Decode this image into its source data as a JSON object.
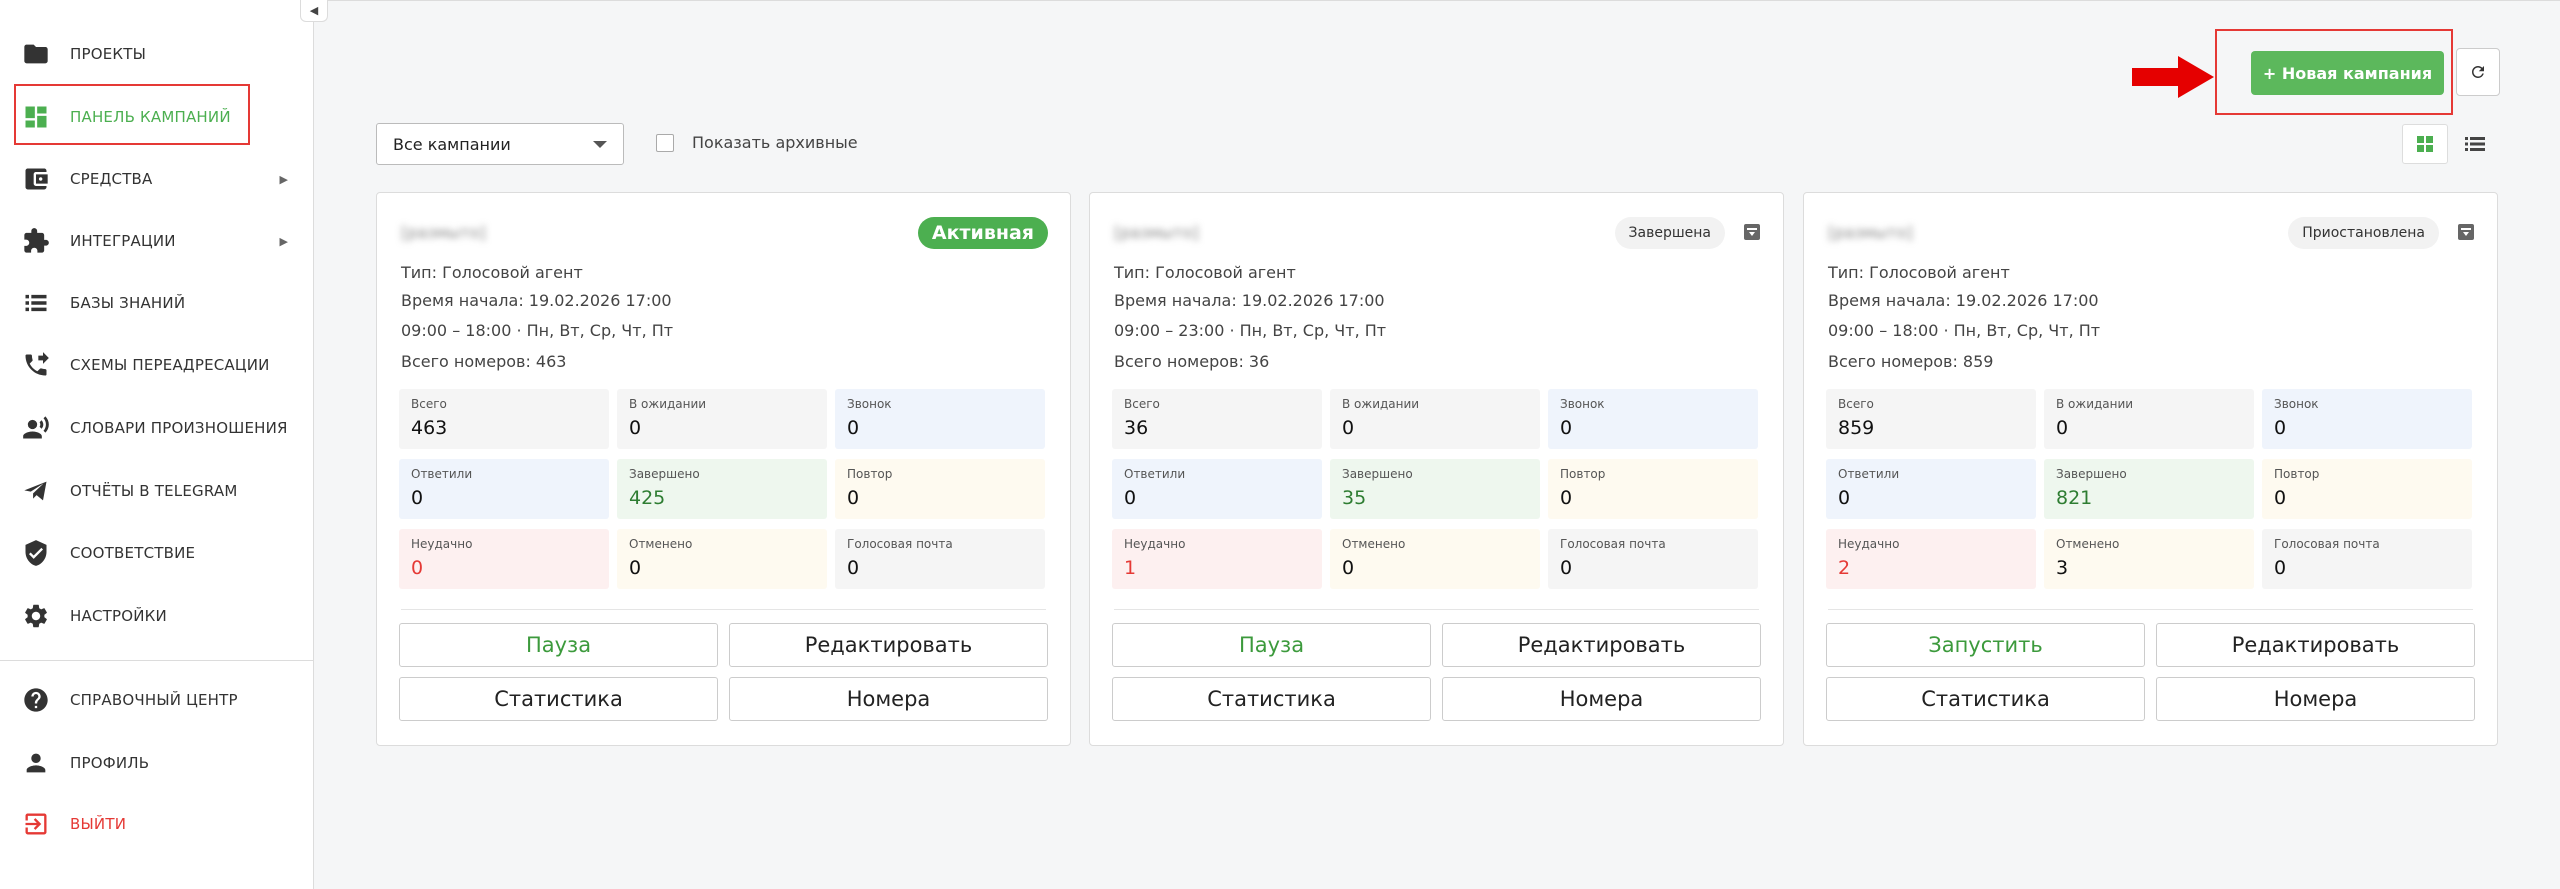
{
  "sidebar": {
    "items": [
      {
        "label": "ПРОЕКТЫ"
      },
      {
        "label": "ПАНЕЛЬ КАМПАНИЙ"
      },
      {
        "label": "СРЕДСТВА"
      },
      {
        "label": "ИНТЕГРАЦИИ"
      },
      {
        "label": "БАЗЫ ЗНАНИЙ"
      },
      {
        "label": "СХЕМЫ ПЕРЕАДРЕСАЦИИ"
      },
      {
        "label": "СЛОВАРИ ПРОИЗНОШЕНИЯ"
      },
      {
        "label": "ОТЧЁТЫ В TELEGRAM"
      },
      {
        "label": "СООТВЕТСТВИЕ"
      },
      {
        "label": "НАСТРОЙКИ"
      },
      {
        "label": "СПРАВОЧНЫЙ ЦЕНТР"
      },
      {
        "label": "ПРОФИЛЬ"
      },
      {
        "label": "ВЫЙТИ"
      }
    ],
    "active_item": "ПАНЕЛЬ КАМПАНИЙ"
  },
  "toolbar": {
    "new_campaign_label": "+ Новая кампания",
    "filter_value": "Все кампании",
    "show_archived_label": "Показать архивные",
    "show_archived_checked": false,
    "view_mode": "grid"
  },
  "colors": {
    "accent": "#4caf50",
    "highlight": "#e53935",
    "danger": "#e53935"
  },
  "stat_labels": {
    "total": "Всего",
    "waiting": "В ожидании",
    "calling": "Звонок",
    "answered": "Ответили",
    "completed": "Завершено",
    "retry": "Повтор",
    "failed": "Неудачно",
    "cancelled": "Отменено",
    "voicemail": "Голосовая почта"
  },
  "campaigns": [
    {
      "name": "[размыто]",
      "status": "Активная",
      "type": "Тип: Голосовой агент",
      "start": "Время начала: 19.02.2026 17:00",
      "schedule": "09:00 – 18:00 · Пн, Вт, Ср, Чт, Пт",
      "total_numbers": "Всего номеров: 463",
      "stats": {
        "total": "463",
        "waiting": "0",
        "calling": "0",
        "answered": "0",
        "completed": "425",
        "retry": "0",
        "failed": "0",
        "cancelled": "0",
        "voicemail": "0"
      },
      "buttons": {
        "primary": "Пауза",
        "edit": "Редактировать",
        "stats": "Статистика",
        "numbers": "Номера"
      }
    },
    {
      "name": "[размыто]",
      "status": "Завершена",
      "type": "Тип: Голосовой агент",
      "start": "Время начала: 19.02.2026 17:00",
      "schedule": "09:00 – 23:00 · Пн, Вт, Ср, Чт, Пт",
      "total_numbers": "Всего номеров: 36",
      "stats": {
        "total": "36",
        "waiting": "0",
        "calling": "0",
        "answered": "0",
        "completed": "35",
        "retry": "0",
        "failed": "1",
        "cancelled": "0",
        "voicemail": "0"
      },
      "buttons": {
        "primary": "Пауза",
        "edit": "Редактировать",
        "stats": "Статистика",
        "numbers": "Номера"
      }
    },
    {
      "name": "[размыто]",
      "status": "Приостановлена",
      "type": "Тип: Голосовой агент",
      "start": "Время начала: 19.02.2026 17:00",
      "schedule": "09:00 – 18:00 · Пн, Вт, Ср, Чт, Пт",
      "total_numbers": "Всего номеров: 859",
      "stats": {
        "total": "859",
        "waiting": "0",
        "calling": "0",
        "answered": "0",
        "completed": "821",
        "retry": "0",
        "failed": "2",
        "cancelled": "3",
        "voicemail": "0"
      },
      "buttons": {
        "primary": "Запустить",
        "edit": "Редактировать",
        "stats": "Статистика",
        "numbers": "Номера"
      }
    }
  ]
}
